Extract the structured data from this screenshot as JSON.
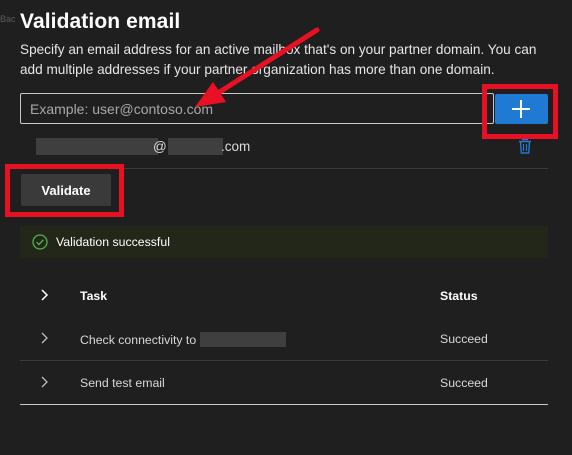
{
  "page": {
    "back_hint": "Bac",
    "title": "Validation email",
    "description": "Specify an email address for an active mailbox that's on your partner domain. You can add multiple addresses if your partner organization has more than one domain."
  },
  "email_input": {
    "placeholder": "Example: user@contoso.com",
    "value": ""
  },
  "add_button": {
    "icon": "plus-icon"
  },
  "added_email": {
    "at": "@",
    "domain_suffix": ".com",
    "delete_icon": "trash-icon"
  },
  "validate_button": {
    "label": "Validate"
  },
  "validation_result": {
    "icon": "check-circle-icon",
    "text": "Validation successful",
    "color": "#22271a"
  },
  "tasks_table": {
    "columns": {
      "task": "Task",
      "status": "Status"
    },
    "rows": [
      {
        "task": "Check connectivity to",
        "status": "Succeed"
      },
      {
        "task": "Send test email",
        "status": "Succeed"
      }
    ]
  },
  "colors": {
    "background": "#1f1f1f",
    "accent": "#1f7ad3",
    "annotation": "#e81123",
    "success": "#4fb24f"
  }
}
